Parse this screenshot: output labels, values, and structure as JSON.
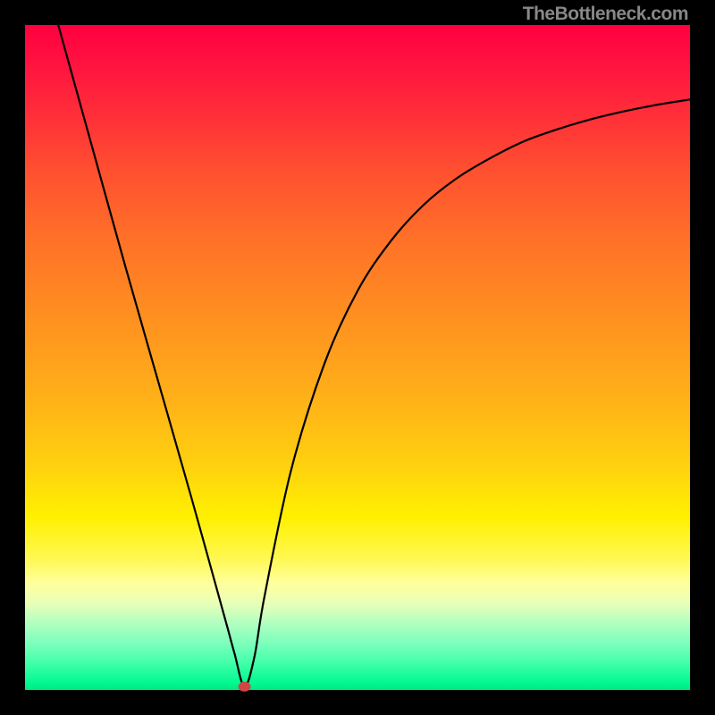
{
  "watermark": "TheBottleneck.com",
  "chart_data": {
    "type": "line",
    "title": "",
    "xlabel": "",
    "ylabel": "",
    "xlim": [
      0,
      100
    ],
    "ylim": [
      0,
      100
    ],
    "grid": false,
    "legend": false,
    "background_gradient": {
      "top": "#ff0040",
      "middle": "#ffe000",
      "bottom": "#00f890"
    },
    "annotations": [
      {
        "type": "marker",
        "x": 33.0,
        "y": 0.5,
        "color": "#d04545"
      }
    ],
    "series": [
      {
        "name": "curve",
        "x": [
          5,
          10,
          15,
          20,
          25,
          30,
          31.5,
          33,
          34.5,
          36,
          40,
          45,
          50,
          55,
          60,
          65,
          70,
          75,
          80,
          85,
          90,
          95,
          100
        ],
        "y": [
          100,
          82,
          64,
          46.5,
          29,
          11,
          5.5,
          0.5,
          5,
          14,
          33,
          49,
          60,
          67.5,
          73,
          77,
          80,
          82.5,
          84.3,
          85.8,
          87,
          88,
          88.8
        ]
      }
    ]
  }
}
